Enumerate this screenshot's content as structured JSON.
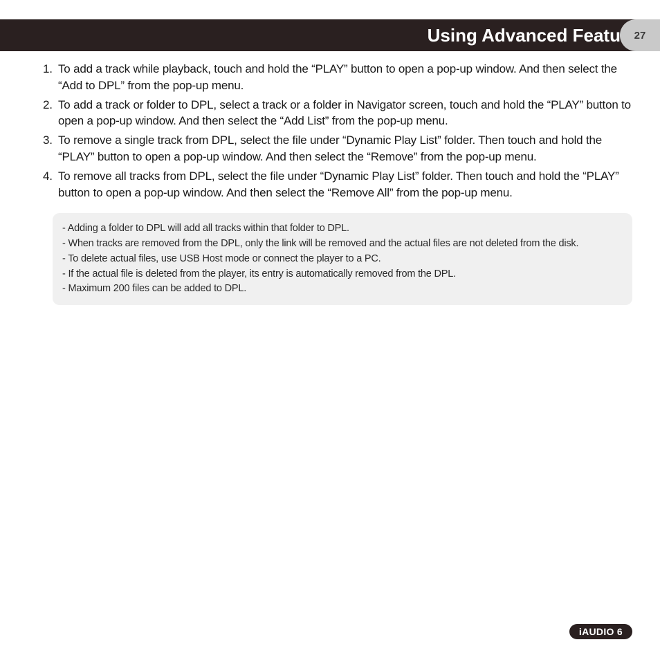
{
  "header": {
    "title": "Using Advanced Features",
    "page_number": "27"
  },
  "instructions": [
    "To add a track while playback, touch and hold the “PLAY” button to open a pop-up window. And then select the “Add to DPL” from the pop-up menu.",
    "To add a track or folder to DPL, select a track or a folder in Navigator screen, touch and hold the “PLAY” button to open a pop-up window. And then select the “Add List” from the pop-up menu.",
    "To remove a single track from DPL, select the file under “Dynamic Play List” folder. Then touch and hold the “PLAY” button to open a pop-up window. And then select the “Remove” from the pop-up menu.",
    "To remove all tracks from DPL, select the file under “Dynamic Play List” folder. Then touch and hold the “PLAY” button to open a pop-up window. And then select the “Remove All” from the pop-up menu."
  ],
  "notes": [
    "- Adding a folder to DPL will add all tracks within that folder to DPL.",
    "- When tracks are removed from the DPL, only the link will be removed and the actual files are not deleted from the disk.",
    "- To delete actual files, use USB Host mode or connect the player to a PC.",
    "- If the actual file is deleted from the player, its entry is automatically removed from the DPL.",
    "- Maximum 200 files can be added to DPL."
  ],
  "footer": {
    "product": "iAUDIO 6"
  }
}
